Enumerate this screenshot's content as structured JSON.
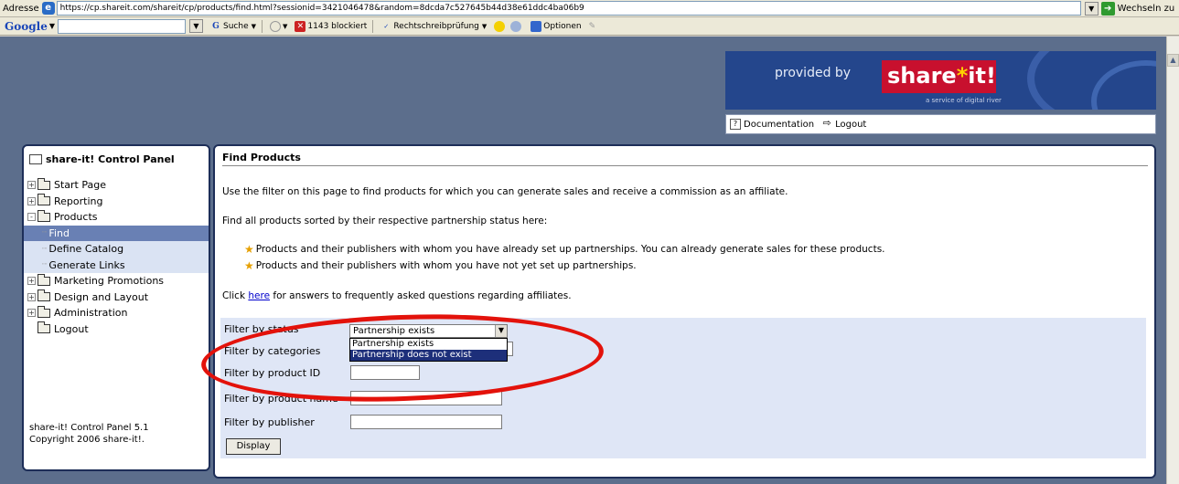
{
  "browser": {
    "address_label": "Adresse",
    "url": "https://cp.shareit.com/shareit/cp/products/find.html?sessionid=3421046478&random=8dcda7c527645b44d38e61ddc4ba06b9",
    "go_label": "Wechseln zu"
  },
  "google_toolbar": {
    "logo": "Google",
    "search_label": "Suche",
    "blocked_label": "1143 blockiert",
    "spellcheck_label": "Rechtschreibprüfung",
    "options_label": "Optionen"
  },
  "banner": {
    "provided_by": "provided by",
    "brand_share": "share",
    "brand_star": "*",
    "brand_it": "it!",
    "brand_sub": "a service of digital river"
  },
  "top_nav": {
    "documentation": "Documentation",
    "logout": "Logout"
  },
  "sidebar": {
    "title": "share-it! Control Panel",
    "items": [
      {
        "label": "Start Page",
        "toggle": "+"
      },
      {
        "label": "Reporting",
        "toggle": "+"
      },
      {
        "label": "Products",
        "toggle": "-"
      },
      {
        "label": "Find"
      },
      {
        "label": "Define Catalog"
      },
      {
        "label": "Generate Links"
      },
      {
        "label": "Marketing Promotions",
        "toggle": "+"
      },
      {
        "label": "Design and Layout",
        "toggle": "+"
      },
      {
        "label": "Administration",
        "toggle": "+"
      },
      {
        "label": "Logout"
      }
    ],
    "footer_line1": "share-it! Control Panel 5.1",
    "footer_line2": "Copyright 2006 share-it!."
  },
  "main": {
    "title": "Find Products",
    "intro": "Use the filter on this page to find products for which you can generate sales and receive a commission as an affiliate.",
    "sorted": "Find all products sorted by their respective partnership status here:",
    "bullet1": "Products and their publishers with whom you have already set up partnerships. You can already generate sales for these products.",
    "bullet2": "Products and their publishers with whom you have not yet set up partnerships.",
    "faq_prefix": "Click",
    "faq_link": "here",
    "faq_suffix": "for answers to frequently asked questions regarding affiliates."
  },
  "filter": {
    "status_label": "Filter by status",
    "status_value": "Partnership exists",
    "status_options": [
      "Partnership exists",
      "Partnership does not exist"
    ],
    "categories_label": "Filter by categories",
    "product_id_label": "Filter by product ID",
    "product_name_label": "Filter by product name",
    "publisher_label": "Filter by publisher",
    "display_button": "Display"
  },
  "colors": {
    "page_bg": "#5c6e8c",
    "panel_border": "#1d2e58",
    "filter_bg": "#dfe6f6",
    "selected_item": "#6980b4",
    "annotation": "#e3120b"
  }
}
